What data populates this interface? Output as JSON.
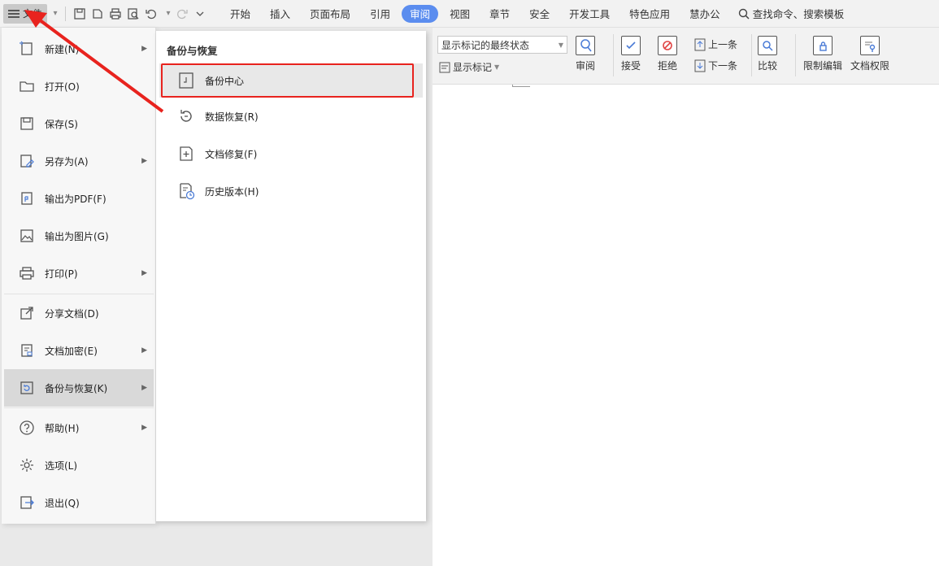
{
  "menubar": {
    "file_label": "文件",
    "tabs": [
      "开始",
      "插入",
      "页面布局",
      "引用",
      "审阅",
      "视图",
      "章节",
      "安全",
      "开发工具",
      "特色应用",
      "慧办公"
    ],
    "active_tab": "审阅",
    "search_label": "查找命令、搜索模板"
  },
  "ribbon": {
    "markup_state": "显示标记的最终状态",
    "show_markup": "显示标记",
    "review": "审阅",
    "accept": "接受",
    "reject": "拒绝",
    "prev": "上一条",
    "next": "下一条",
    "compare": "比较",
    "restrict_edit": "限制编辑",
    "doc_permission": "文档权限"
  },
  "file_menu": {
    "items": [
      {
        "label": "新建(N)",
        "icon": "new-doc-icon",
        "submenu": true
      },
      {
        "label": "打开(O)",
        "icon": "folder-icon",
        "submenu": false
      },
      {
        "label": "保存(S)",
        "icon": "save-icon",
        "submenu": false
      },
      {
        "label": "另存为(A)",
        "icon": "save-as-icon",
        "submenu": true
      },
      {
        "label": "输出为PDF(F)",
        "icon": "pdf-icon",
        "submenu": false
      },
      {
        "label": "输出为图片(G)",
        "icon": "image-icon",
        "submenu": false
      },
      {
        "label": "打印(P)",
        "icon": "print-icon",
        "submenu": true
      },
      {
        "label": "分享文档(D)",
        "icon": "share-icon",
        "submenu": false
      },
      {
        "label": "文档加密(E)",
        "icon": "encrypt-icon",
        "submenu": true
      },
      {
        "label": "备份与恢复(K)",
        "icon": "backup-icon",
        "submenu": true
      },
      {
        "label": "帮助(H)",
        "icon": "help-icon",
        "submenu": true
      },
      {
        "label": "选项(L)",
        "icon": "gear-icon",
        "submenu": false
      },
      {
        "label": "退出(Q)",
        "icon": "exit-icon",
        "submenu": false
      }
    ],
    "active_item": "备份与恢复(K)"
  },
  "submenu": {
    "title": "备份与恢复",
    "items": [
      {
        "label": "备份中心",
        "icon": "backup-center-icon"
      },
      {
        "label": "数据恢复(R)",
        "icon": "data-recovery-icon"
      },
      {
        "label": "文档修复(F)",
        "icon": "doc-repair-icon"
      },
      {
        "label": "历史版本(H)",
        "icon": "history-icon"
      }
    ],
    "highlighted_item": "备份中心"
  },
  "colors": {
    "active_tab_bg": "#5b8def",
    "annotation_red": "#e8231e"
  }
}
